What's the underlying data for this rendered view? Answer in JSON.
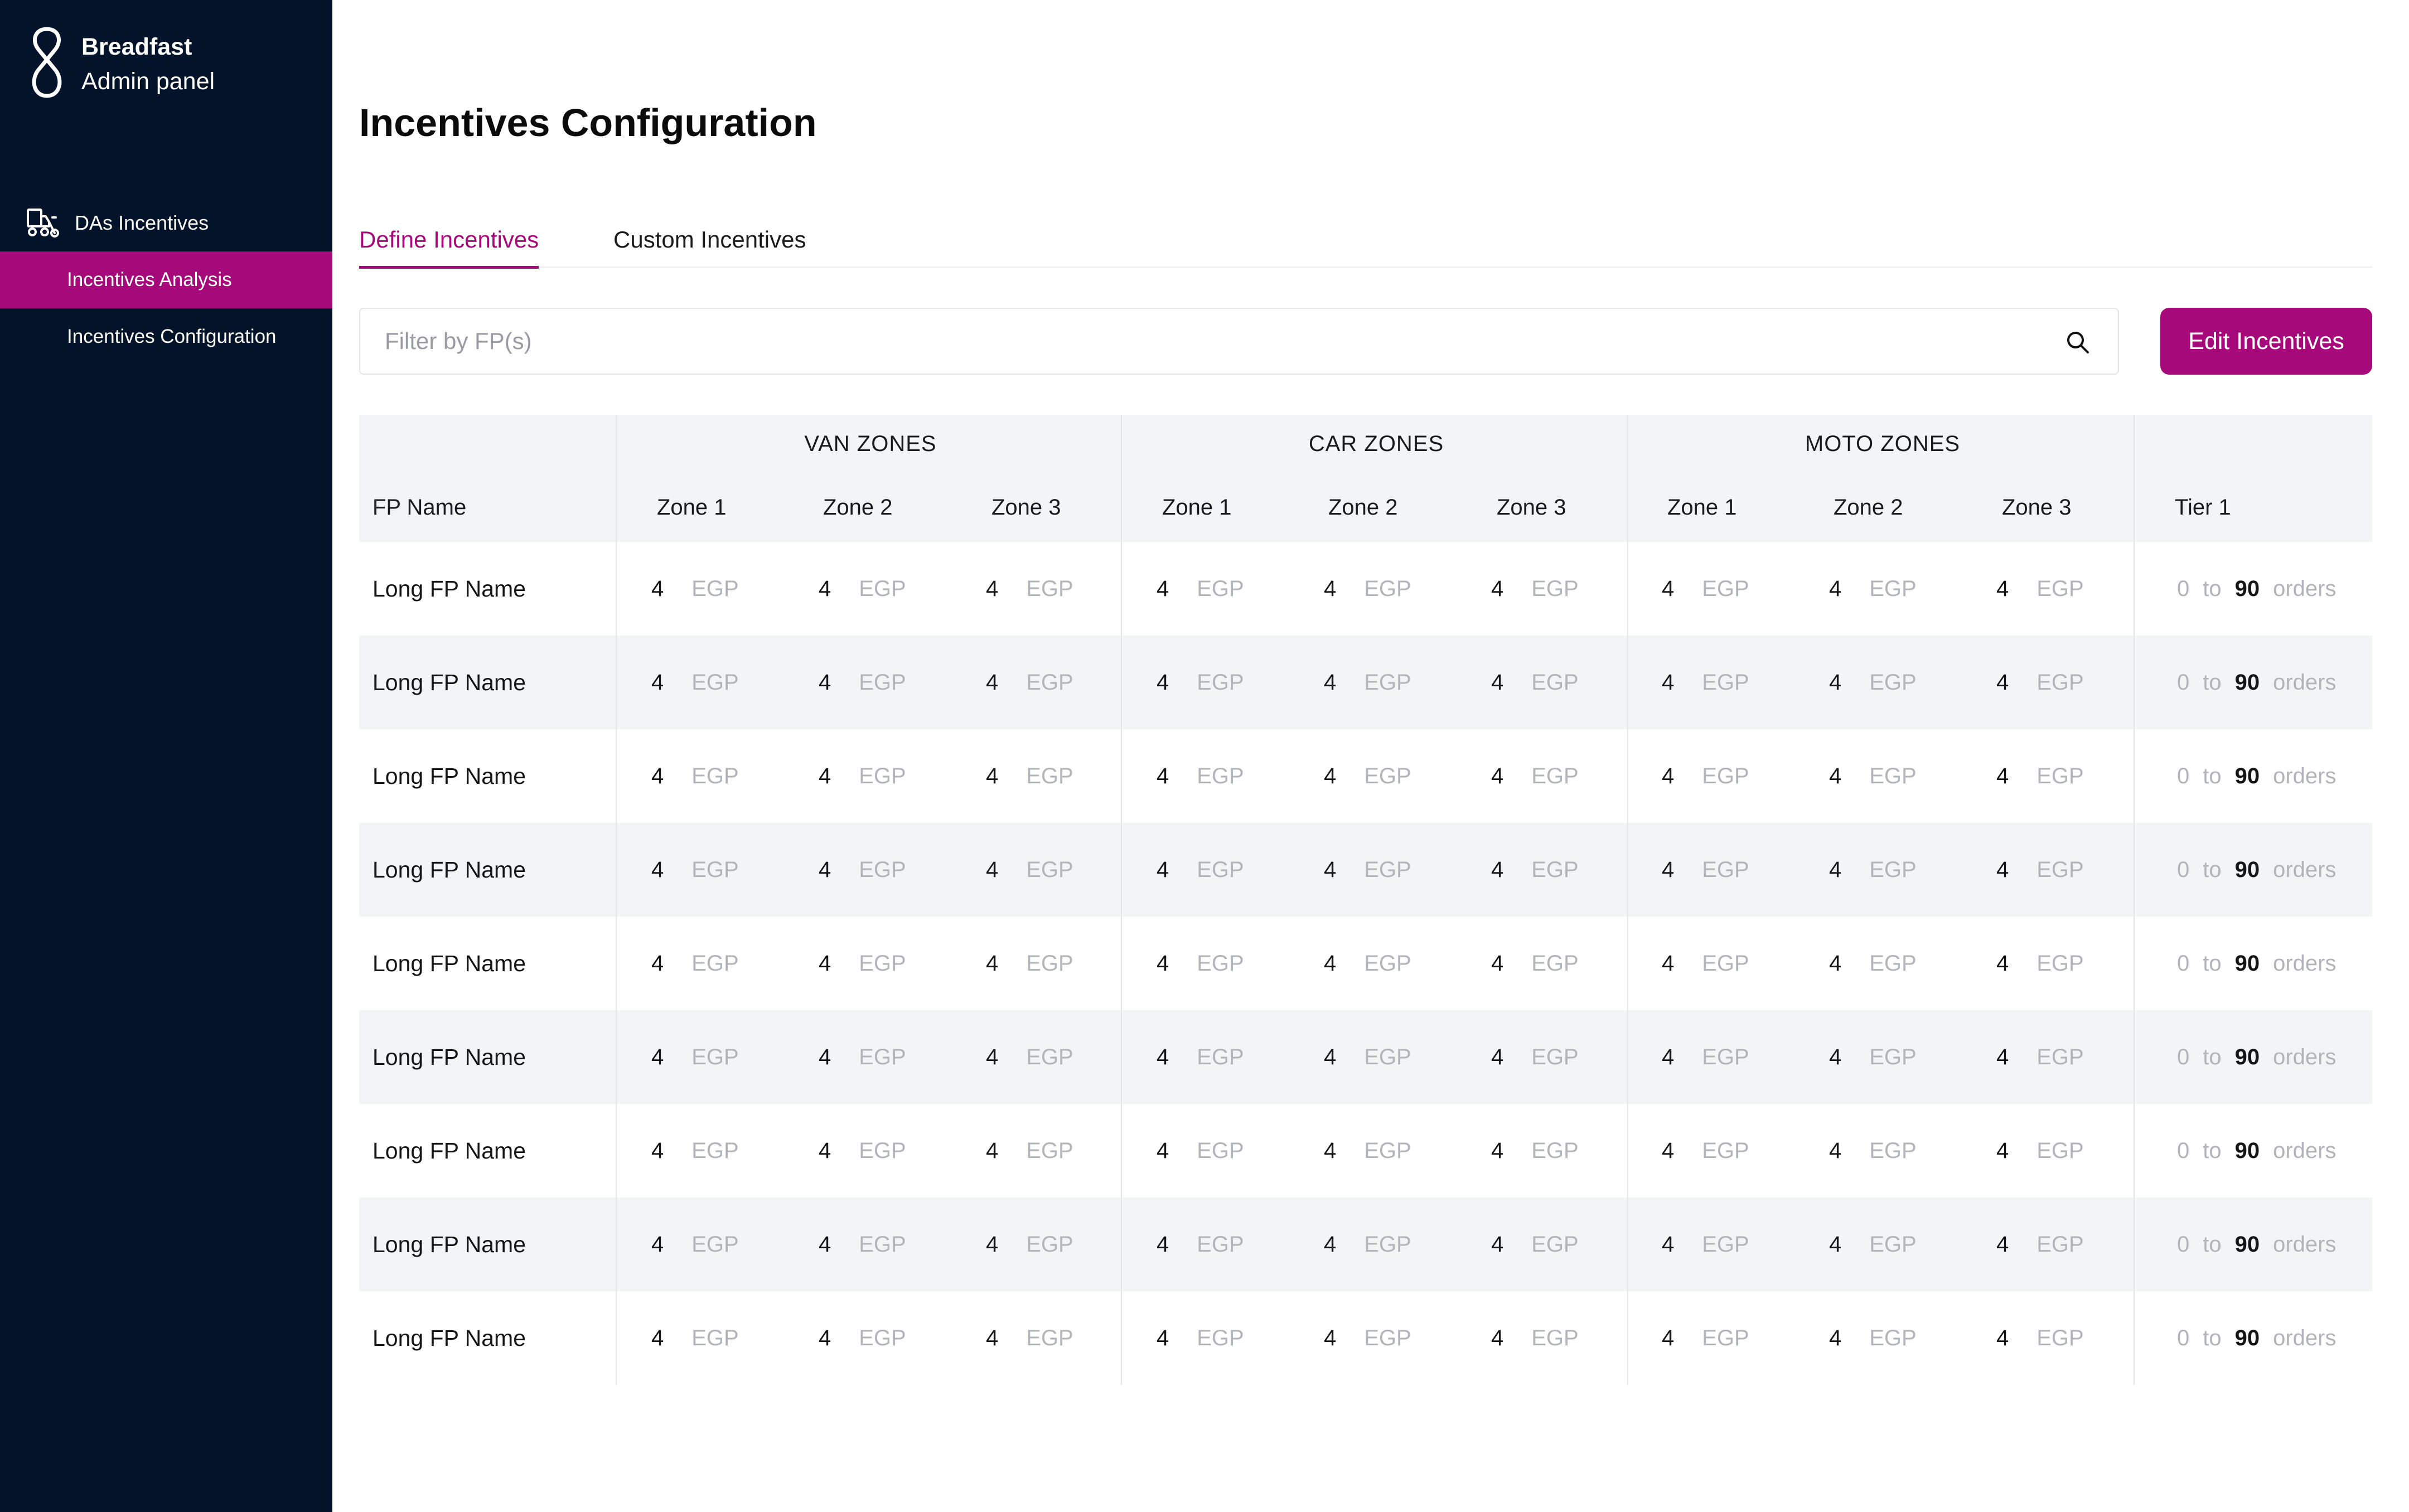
{
  "sidebar": {
    "brand_name": "Breadfast",
    "brand_sub": "Admin panel",
    "group_label": "DAs Incentives",
    "group_icon": "truck-bike-icon",
    "items": [
      {
        "label": "Incentives Analysis",
        "active": true
      },
      {
        "label": "Incentives Configuration",
        "active": false
      }
    ]
  },
  "page": {
    "title": "Incentives Configuration",
    "tabs": [
      {
        "label": "Define Incentives",
        "active": true
      },
      {
        "label": "Custom Incentives",
        "active": false
      }
    ],
    "filter_placeholder": "Filter by FP(s)",
    "edit_button": "Edit Incentives"
  },
  "colors": {
    "sidebar_bg": "#03142a",
    "accent": "#a5097a",
    "header_bg": "#f3f4f6",
    "muted_text": "#b3b4ba"
  },
  "table": {
    "fp_header": "FP Name",
    "groups": [
      {
        "label": "VAN ZONES",
        "columns": [
          "Zone 1",
          "Zone 2",
          "Zone 3"
        ]
      },
      {
        "label": "CAR ZONES",
        "columns": [
          "Zone 1",
          "Zone 2",
          "Zone 3"
        ]
      },
      {
        "label": "MOTO ZONES",
        "columns": [
          "Zone 1",
          "Zone 2",
          "Zone 3"
        ]
      }
    ],
    "tier_header": "Tier 1",
    "currency": "EGP",
    "tier_to_word": "to",
    "tier_unit": "orders",
    "rows": [
      {
        "fp": "Long FP Name",
        "values": [
          "4",
          "4",
          "4",
          "4",
          "4",
          "4",
          "4",
          "4",
          "4"
        ],
        "tier_from": "0",
        "tier_to": "90"
      },
      {
        "fp": "Long FP Name",
        "values": [
          "4",
          "4",
          "4",
          "4",
          "4",
          "4",
          "4",
          "4",
          "4"
        ],
        "tier_from": "0",
        "tier_to": "90"
      },
      {
        "fp": "Long FP Name",
        "values": [
          "4",
          "4",
          "4",
          "4",
          "4",
          "4",
          "4",
          "4",
          "4"
        ],
        "tier_from": "0",
        "tier_to": "90"
      },
      {
        "fp": "Long FP Name",
        "values": [
          "4",
          "4",
          "4",
          "4",
          "4",
          "4",
          "4",
          "4",
          "4"
        ],
        "tier_from": "0",
        "tier_to": "90"
      },
      {
        "fp": "Long FP Name",
        "values": [
          "4",
          "4",
          "4",
          "4",
          "4",
          "4",
          "4",
          "4",
          "4"
        ],
        "tier_from": "0",
        "tier_to": "90"
      },
      {
        "fp": "Long FP Name",
        "values": [
          "4",
          "4",
          "4",
          "4",
          "4",
          "4",
          "4",
          "4",
          "4"
        ],
        "tier_from": "0",
        "tier_to": "90"
      },
      {
        "fp": "Long FP Name",
        "values": [
          "4",
          "4",
          "4",
          "4",
          "4",
          "4",
          "4",
          "4",
          "4"
        ],
        "tier_from": "0",
        "tier_to": "90"
      },
      {
        "fp": "Long FP Name",
        "values": [
          "4",
          "4",
          "4",
          "4",
          "4",
          "4",
          "4",
          "4",
          "4"
        ],
        "tier_from": "0",
        "tier_to": "90"
      },
      {
        "fp": "Long FP Name",
        "values": [
          "4",
          "4",
          "4",
          "4",
          "4",
          "4",
          "4",
          "4",
          "4"
        ],
        "tier_from": "0",
        "tier_to": "90"
      }
    ]
  }
}
